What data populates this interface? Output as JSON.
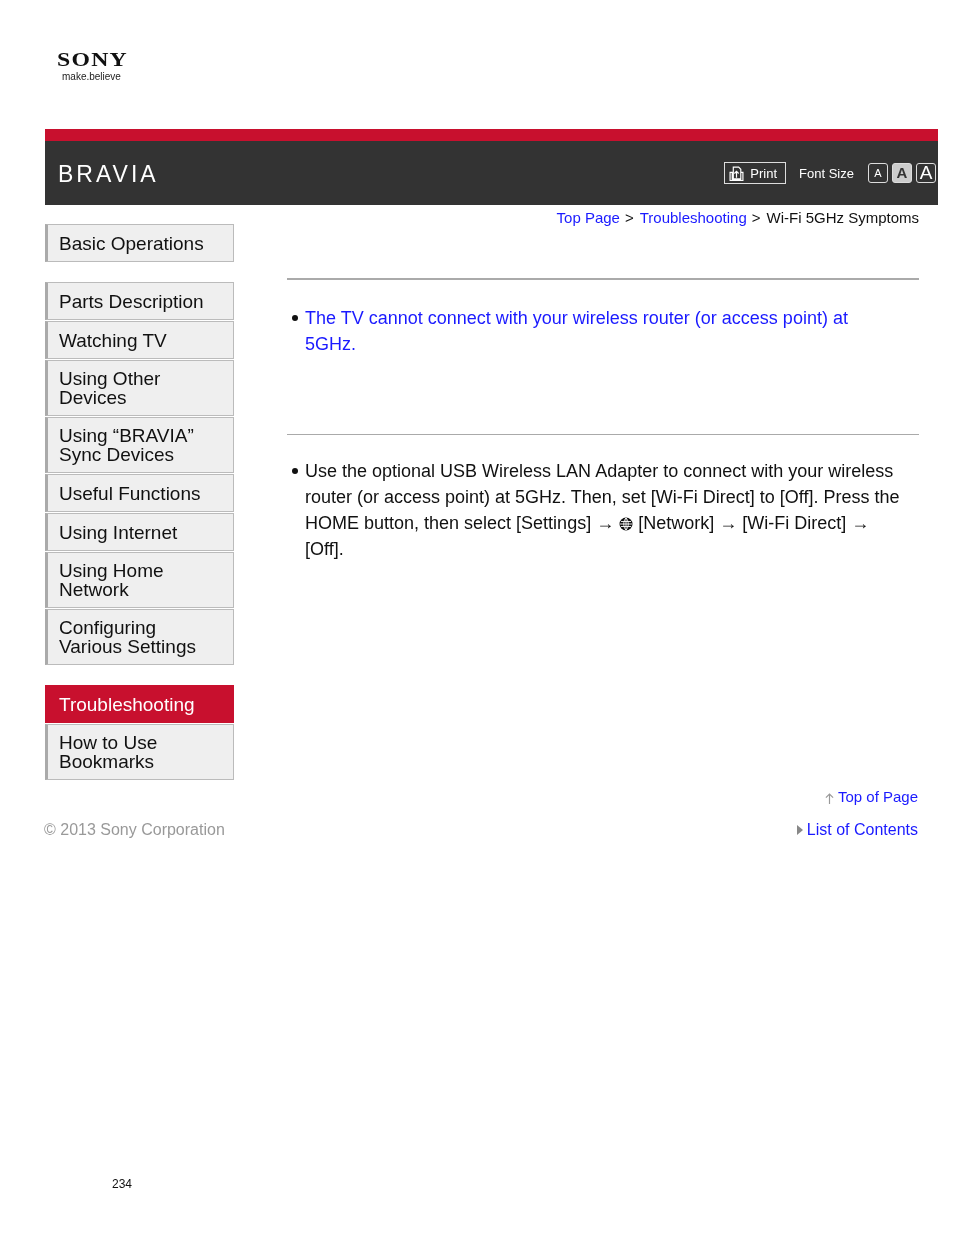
{
  "brand": {
    "logo": "SONY",
    "tagline": "make.believe"
  },
  "header": {
    "product": "BRAVIA",
    "print": "Print",
    "font_size_label": "Font Size",
    "font_sizes": [
      {
        "label": "A",
        "kind": "small",
        "selected": false
      },
      {
        "label": "A",
        "kind": "medium",
        "selected": true
      },
      {
        "label": "A",
        "kind": "large",
        "selected": false
      }
    ]
  },
  "breadcrumb": [
    {
      "label": "Top Page",
      "kind": "link"
    },
    {
      "label": ">",
      "kind": "separator"
    },
    {
      "label": "Troubleshooting",
      "kind": "link"
    },
    {
      "label": ">",
      "kind": "separator"
    },
    {
      "label": "Wi-Fi 5GHz Symptoms",
      "kind": "current"
    }
  ],
  "sidebar": {
    "groups": [
      [
        {
          "label": "Basic Operations",
          "selected": false
        }
      ],
      [
        {
          "label": "Parts Description",
          "selected": false
        },
        {
          "label": "Watching TV",
          "selected": false
        },
        {
          "label": "Using Other Devices",
          "selected": false
        },
        {
          "label": "Using “BRAVIA” Sync Devices",
          "selected": false
        },
        {
          "label": "Useful Functions",
          "selected": false
        },
        {
          "label": "Using Internet",
          "selected": false
        },
        {
          "label": "Using Home Network",
          "selected": false
        },
        {
          "label": "Configuring Various Settings",
          "selected": false
        }
      ],
      [
        {
          "label": "Troubleshooting",
          "selected": true
        },
        {
          "label": "How to Use Bookmarks",
          "selected": false
        }
      ]
    ]
  },
  "symptom": "The TV cannot connect with your wireless router (or access point) at 5GHz.",
  "solution": {
    "before_icon": "Use the optional USB Wireless LAN Adapter to connect with your wireless router (or access point) at 5GHz. Then, set [Wi-Fi Direct] to [Off]. Press the HOME button, then select [Settings] →",
    "after_icon": "[Network] → [Wi-Fi Direct] → [Off]."
  },
  "footer": {
    "copyright": "© 2013 Sony Corporation",
    "top_of_page": "Top of Page",
    "list_of_contents": "List of Contents"
  },
  "page_number": "234"
}
